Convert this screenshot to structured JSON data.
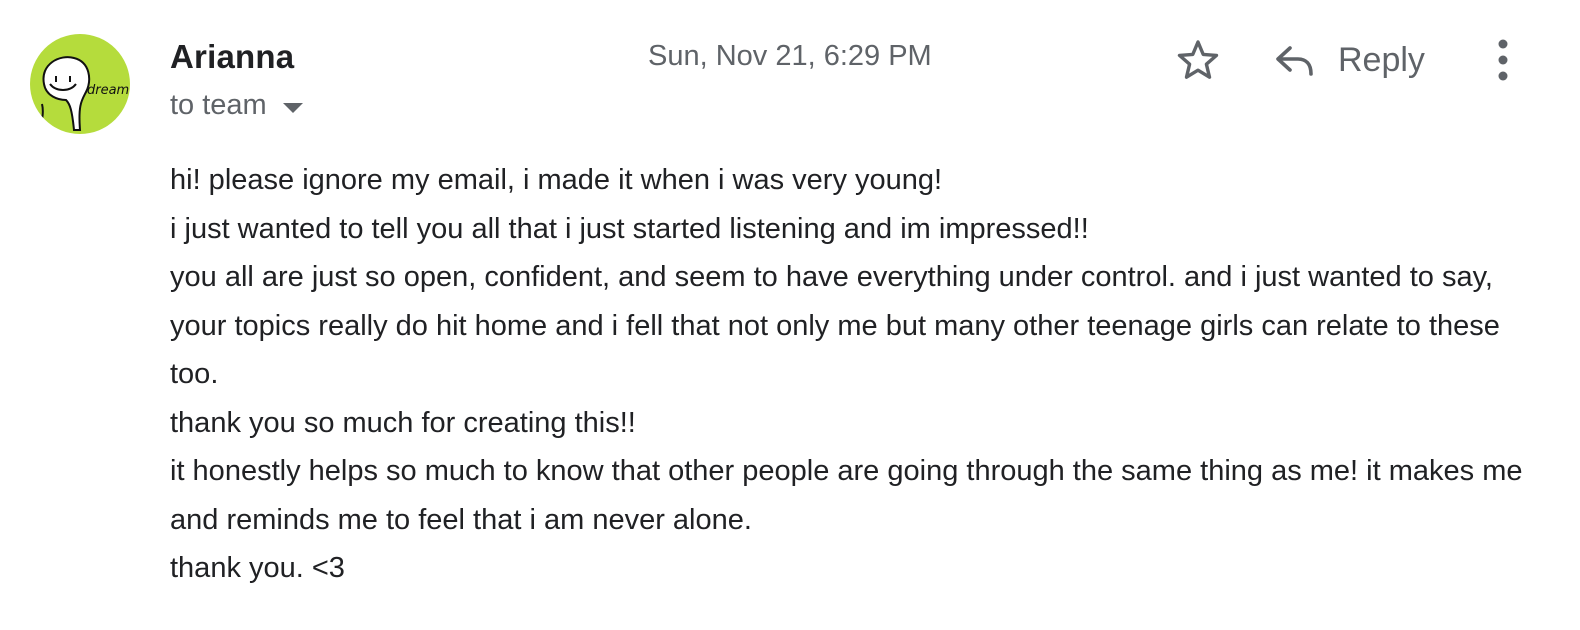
{
  "sender": {
    "name": "Arianna",
    "avatar_text": "dream",
    "avatar_color": "#b5dc3c"
  },
  "recipients": {
    "label": "to team"
  },
  "timestamp": "Sun, Nov 21, 6:29 PM",
  "actions": {
    "star_icon": "star-icon",
    "reply_icon": "reply-icon",
    "reply_label": "Reply",
    "more_icon": "more-vert-icon"
  },
  "message": {
    "lines": [
      "hi! please ignore my email, i made it when i was very young!",
      "i just wanted to tell you all that i just started listening and im impressed!!",
      "you all are just so open, confident, and seem to have everything under control. and i just wanted to say, your topics really do hit home and i fell that not only me but many other teenage girls can relate to these too.",
      "thank you so much for creating this!!",
      "it honestly helps so much to know that other people are going through the same thing as me! it makes me and reminds me to feel that i am never alone.",
      "thank you. <3"
    ]
  },
  "colors": {
    "text_primary": "#202124",
    "text_secondary": "#5f6368",
    "icon": "#5f6368"
  }
}
